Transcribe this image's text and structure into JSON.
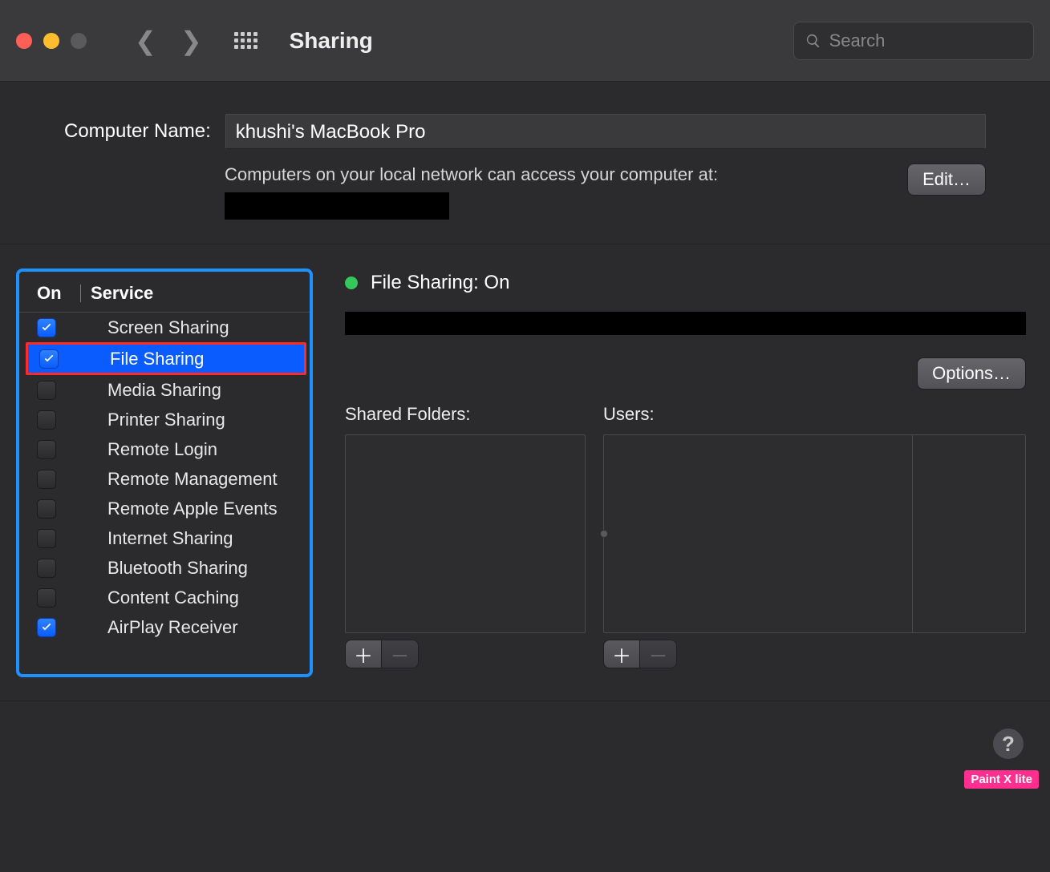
{
  "window": {
    "title": "Sharing",
    "search_placeholder": "Search"
  },
  "upper": {
    "computer_name_label": "Computer Name:",
    "computer_name_value": "khushi's MacBook Pro",
    "subtext": "Computers on your local network can access your computer at:",
    "edit_label": "Edit…"
  },
  "services": {
    "header_on": "On",
    "header_service": "Service",
    "items": [
      {
        "label": "Screen Sharing",
        "checked": true,
        "selected": false
      },
      {
        "label": "File Sharing",
        "checked": true,
        "selected": true
      },
      {
        "label": "Media Sharing",
        "checked": false,
        "selected": false
      },
      {
        "label": "Printer Sharing",
        "checked": false,
        "selected": false
      },
      {
        "label": "Remote Login",
        "checked": false,
        "selected": false
      },
      {
        "label": "Remote Management",
        "checked": false,
        "selected": false
      },
      {
        "label": "Remote Apple Events",
        "checked": false,
        "selected": false
      },
      {
        "label": "Internet Sharing",
        "checked": false,
        "selected": false
      },
      {
        "label": "Bluetooth Sharing",
        "checked": false,
        "selected": false
      },
      {
        "label": "Content Caching",
        "checked": false,
        "selected": false
      },
      {
        "label": "AirPlay Receiver",
        "checked": true,
        "selected": false
      }
    ]
  },
  "detail": {
    "status_text": "File Sharing: On",
    "options_label": "Options…",
    "shared_folders_label": "Shared Folders:",
    "users_label": "Users:"
  },
  "help_glyph": "?",
  "badge_text": "Paint X lite"
}
